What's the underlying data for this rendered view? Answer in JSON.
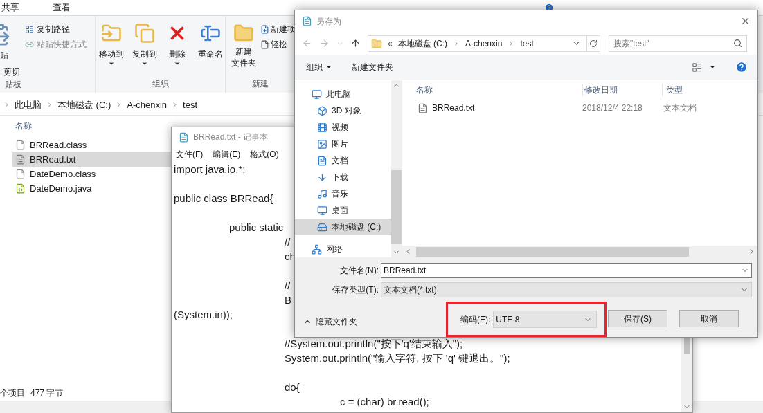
{
  "explorer": {
    "ribbon_tabs": [
      {
        "label": "共享",
        "selected": false
      },
      {
        "label": "查看",
        "selected": false
      }
    ],
    "clipboard": {
      "label": "贴板",
      "paste": "贴",
      "cut": "剪切",
      "copy_path": "复制路径",
      "paste_shortcut": {
        "label": "粘贴快捷方式",
        "disabled": true
      }
    },
    "organize": {
      "label": "组织",
      "buttons": [
        {
          "label": "移动到",
          "dropdown": true
        },
        {
          "label": "复制到",
          "dropdown": true
        },
        {
          "label": "删除",
          "dropdown": true
        },
        {
          "label": "重命名",
          "dropdown": false
        }
      ]
    },
    "new": {
      "label": "新建",
      "new_folder": [
        "新建",
        "文件夹"
      ],
      "small": [
        "新建项",
        "轻松"
      ]
    },
    "address": [
      "此电脑",
      "本地磁盘 (C:)",
      "A-chenxin",
      "test"
    ],
    "column": "名称",
    "files": [
      {
        "name": "BRRead.class",
        "selected": false
      },
      {
        "name": "BRRead.txt",
        "selected": true
      },
      {
        "name": "DateDemo.class",
        "selected": false
      },
      {
        "name": "DateDemo.java",
        "selected": false
      }
    ],
    "status": [
      "个项目",
      "477 字节"
    ]
  },
  "notepad": {
    "title": "BRRead.txt - 记事本",
    "menu": [
      "文件(F)",
      "编辑(E)",
      "格式(O)"
    ],
    "paragraphs": [
      [
        "import java.io.*;"
      ],
      [
        "public class BRRead{"
      ],
      [
        "\tpublic static",
        "\t\t//",
        "\t\tch"
      ],
      [
        "\t\t//",
        "\t\tB",
        "(System.in));"
      ],
      [
        "\t\t//System.out.println(\"按下'q'结束输入\");",
        "\t\tSystem.out.println(\"输入字符, 按下 'q' 键退出。\");"
      ],
      [
        "\t\tdo{",
        "\t\t\tc = (char) br.read();"
      ]
    ]
  },
  "dialog": {
    "title": "另存为",
    "address": {
      "overflow": "«",
      "segments": [
        "本地磁盘 (C:)",
        "A-chenxin",
        "test"
      ]
    },
    "search": {
      "placeholder": "搜索\"test\""
    },
    "toolbar": [
      {
        "label": "组织",
        "dropdown": true
      },
      {
        "label": "新建文件夹",
        "dropdown": false
      }
    ],
    "tree": [
      {
        "label": "此电脑",
        "selected": false,
        "children": [
          {
            "label": "3D 对象",
            "selected": false
          },
          {
            "label": "视频",
            "selected": false
          },
          {
            "label": "图片",
            "selected": false
          },
          {
            "label": "文档",
            "selected": false
          },
          {
            "label": "下载",
            "selected": false
          },
          {
            "label": "音乐",
            "selected": false
          },
          {
            "label": "桌面",
            "selected": false
          },
          {
            "label": "本地磁盘 (C:)",
            "selected": true
          }
        ]
      },
      {
        "label": "网络",
        "selected": false
      }
    ],
    "columns": [
      "名称",
      "修改日期",
      "类型"
    ],
    "rows": [
      {
        "name": "BRRead.txt",
        "modified": "2018/12/4 22:18",
        "type": "文本文档"
      }
    ],
    "file_name": {
      "label": "文件名(N):",
      "value": "BRRead.txt"
    },
    "save_type": {
      "label": "保存类型(T):",
      "value": "文本文档(*.txt)"
    },
    "hide_folders": "隐藏文件夹",
    "encoding": {
      "label": "编码(E):",
      "value": "UTF-8",
      "highlighted": true
    },
    "buttons": [
      "保存(S)",
      "取消"
    ]
  }
}
